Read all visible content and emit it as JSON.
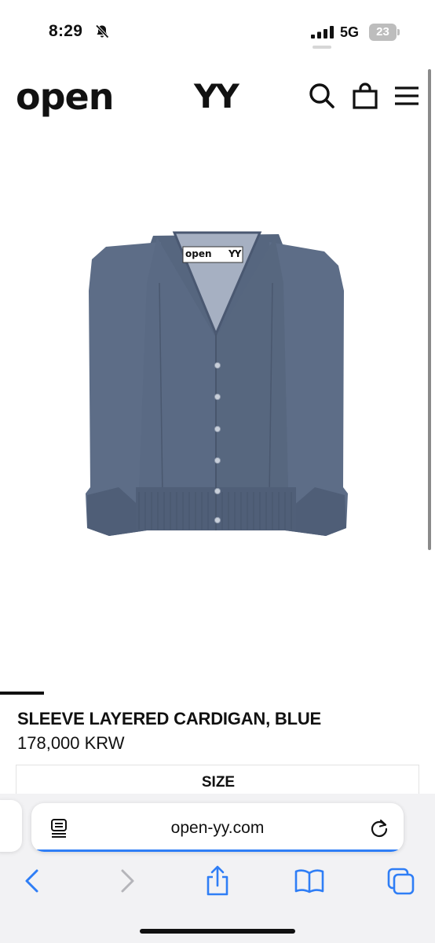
{
  "status_bar": {
    "time": "8:29",
    "network": "5G",
    "battery": "23",
    "icons": [
      "bell-slash-icon",
      "signal-icon",
      "battery-icon"
    ]
  },
  "header": {
    "logo_left": "open",
    "logo_right": "YY",
    "icons": [
      "search-icon",
      "shopping-bag-icon",
      "menu-icon"
    ]
  },
  "product": {
    "image_label_left": "open",
    "image_label_right": "YY",
    "title": "SLEEVE LAYERED CARDIGAN, BLUE",
    "price": "178,000 KRW",
    "size_label": "SIZE",
    "garment_color": "#5b6b85"
  },
  "browser": {
    "url": "open-yy.com",
    "accent": "#2f7ef6",
    "toolbar_icons": [
      "back-icon",
      "forward-icon",
      "share-icon",
      "bookmarks-icon",
      "tabs-icon"
    ]
  }
}
